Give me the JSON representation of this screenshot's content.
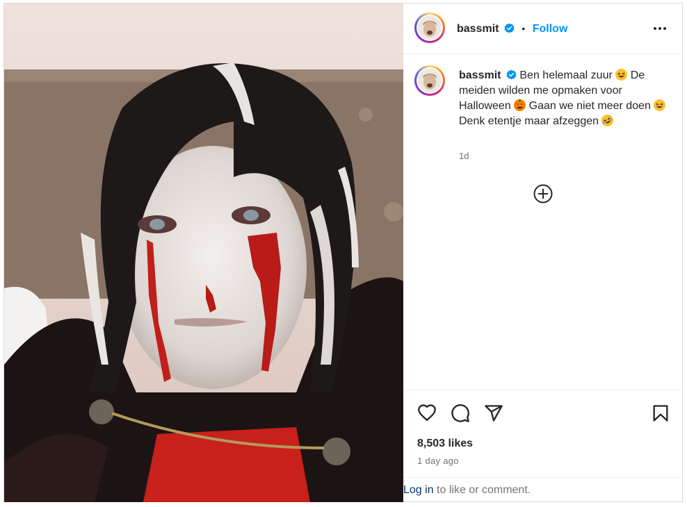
{
  "post": {
    "username": "bassmit",
    "follow_label": "Follow",
    "dot_separator": "•",
    "caption": {
      "part1": "Ben helemaal zuur",
      "part2": "De meiden wilden me opmaken voor Halloween",
      "part3": "Gaan we niet meer doen",
      "part4": "Denk etentje maar afzeggen"
    },
    "caption_age": "1d",
    "likes": "8,503 likes",
    "posted_ago": "1 day ago"
  },
  "login": {
    "link_label": "Log in",
    "rest": "to like or comment."
  },
  "icons": {
    "verified": "verified-badge-icon",
    "more": "more-options-icon",
    "add": "add-circle-icon",
    "like": "heart-icon",
    "comment": "comment-icon",
    "share": "share-icon",
    "save": "bookmark-icon"
  },
  "colors": {
    "accent": "#0095f6",
    "link": "#00376b",
    "muted": "#737373",
    "text": "#262626"
  }
}
